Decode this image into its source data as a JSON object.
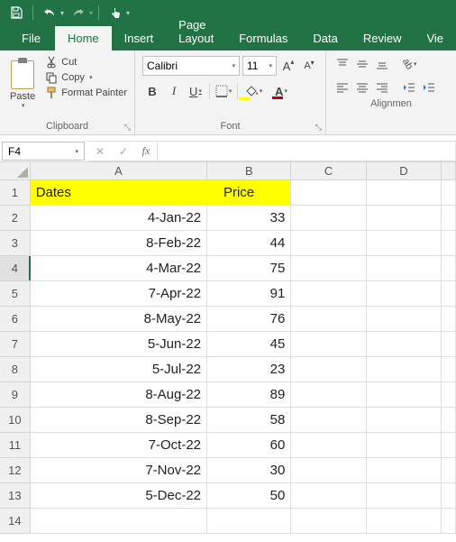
{
  "qat": {
    "save": "save-icon",
    "undo": "undo-icon",
    "redo": "redo-icon",
    "touch": "touch-icon"
  },
  "tabs": {
    "file": "File",
    "home": "Home",
    "insert": "Insert",
    "page_layout": "Page Layout",
    "formulas": "Formulas",
    "data": "Data",
    "review": "Review",
    "view": "Vie"
  },
  "ribbon": {
    "clipboard": {
      "paste": "Paste",
      "cut": "Cut",
      "copy": "Copy",
      "format_painter": "Format Painter",
      "label": "Clipboard"
    },
    "font": {
      "name": "Calibri",
      "size": "11",
      "label": "Font",
      "fill_color": "#ffff00",
      "font_color": "#c00000"
    },
    "alignment": {
      "label": "Alignmen"
    }
  },
  "name_box": "F4",
  "formula_value": "",
  "columns": [
    "A",
    "B",
    "C",
    "D"
  ],
  "sheet": {
    "header": {
      "a": "Dates",
      "b": "Price"
    },
    "rows": [
      {
        "n": "1",
        "a": "Dates",
        "b": "Price",
        "hdr": true
      },
      {
        "n": "2",
        "a": "4-Jan-22",
        "b": "33"
      },
      {
        "n": "3",
        "a": "8-Feb-22",
        "b": "44"
      },
      {
        "n": "4",
        "a": "4-Mar-22",
        "b": "75",
        "sel": true
      },
      {
        "n": "5",
        "a": "7-Apr-22",
        "b": "91"
      },
      {
        "n": "6",
        "a": "8-May-22",
        "b": "76"
      },
      {
        "n": "7",
        "a": "5-Jun-22",
        "b": "45"
      },
      {
        "n": "8",
        "a": "5-Jul-22",
        "b": "23"
      },
      {
        "n": "9",
        "a": "8-Aug-22",
        "b": "89"
      },
      {
        "n": "10",
        "a": "8-Sep-22",
        "b": "58"
      },
      {
        "n": "11",
        "a": "7-Oct-22",
        "b": "60"
      },
      {
        "n": "12",
        "a": "7-Nov-22",
        "b": "30"
      },
      {
        "n": "13",
        "a": "5-Dec-22",
        "b": "50"
      },
      {
        "n": "14",
        "a": "",
        "b": ""
      }
    ]
  }
}
